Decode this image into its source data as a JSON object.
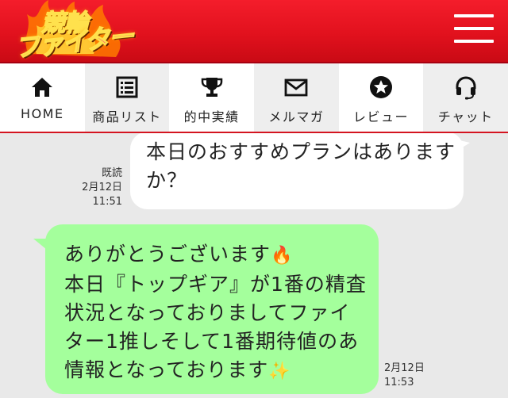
{
  "header": {
    "logo_line1": "競輪",
    "logo_line2": "ファイター",
    "brand_color": "#e1111d"
  },
  "nav": {
    "items": [
      {
        "label": "HOME",
        "icon": "home-icon"
      },
      {
        "label": "商品リスト",
        "icon": "list-icon"
      },
      {
        "label": "的中実績",
        "icon": "trophy-icon"
      },
      {
        "label": "メルマガ",
        "icon": "mail-icon"
      },
      {
        "label": "レビュー",
        "icon": "star-icon"
      },
      {
        "label": "チャット",
        "icon": "headset-icon"
      }
    ]
  },
  "chat": {
    "messages": [
      {
        "side": "right",
        "text": "本日のおすすめプランはありますか？",
        "read": "既読",
        "date": "2月12日",
        "time": "11:51"
      },
      {
        "side": "left",
        "lines": [
          "ありがとうございます",
          "本日『トップギア』が1番の精査",
          "状況となっておりましてファイ",
          "ター1推しそして1番期待値のあ",
          "情報となっております"
        ],
        "emoji_fire": "🔥",
        "emoji_sparkles": "✨",
        "date": "2月12日",
        "time": "11:53"
      }
    ],
    "bubble_green": "#a4ff9c"
  }
}
